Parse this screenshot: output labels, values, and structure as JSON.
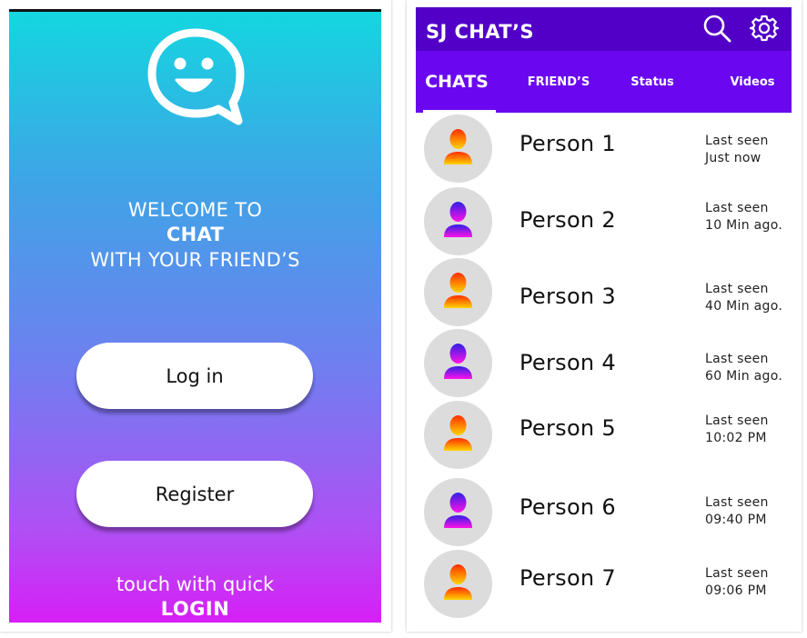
{
  "welcome_screen": {
    "logo_icon": "smiley-chat-bubble-icon",
    "welcome_line1": "WELCOME TO",
    "welcome_line2": "CHAT",
    "welcome_line3": "WITH YOUR FRIEND’S",
    "login_label": "Log in",
    "register_label": "Register",
    "quick_line1": "touch with quick",
    "quick_line2": "LOGIN",
    "colors": {
      "gradient_top": "#14d6e0",
      "gradient_bottom": "#d61ff6",
      "button_bg": "#ffffff"
    }
  },
  "chat_screen": {
    "title": "SJ CHAT’S",
    "header_icons": [
      "search-icon",
      "gear-icon"
    ],
    "tabs": [
      {
        "label": "CHATS",
        "active": true
      },
      {
        "label": "FRIEND’S",
        "active": false
      },
      {
        "label": "Status",
        "active": false
      },
      {
        "label": "Videos",
        "active": false
      }
    ],
    "colors": {
      "topbar": "#5200c8",
      "tabbar": "#6a07f0",
      "avatar_bg": "#dcdcdc",
      "avatar_warm": "#ff3d00",
      "avatar_cool": "#3b1de8"
    },
    "contacts": [
      {
        "name": "Person 1",
        "last_seen_label": "Last seen",
        "last_seen": "Just now",
        "avatar_style": "warm"
      },
      {
        "name": "Person 2",
        "last_seen_label": "Last seen",
        "last_seen": "10 Min ago.",
        "avatar_style": "cool"
      },
      {
        "name": "Person 3",
        "last_seen_label": "Last seen",
        "last_seen": "40 Min ago.",
        "avatar_style": "warm"
      },
      {
        "name": "Person 4",
        "last_seen_label": "Last seen",
        "last_seen": "60 Min ago.",
        "avatar_style": "cool"
      },
      {
        "name": "Person 5",
        "last_seen_label": "Last seen",
        "last_seen": "10:02 PM",
        "avatar_style": "warm"
      },
      {
        "name": "Person 6",
        "last_seen_label": "Last seen",
        "last_seen": "09:40 PM",
        "avatar_style": "cool"
      },
      {
        "name": "Person 7",
        "last_seen_label": "Last seen",
        "last_seen": "09:06 PM",
        "avatar_style": "warm"
      }
    ]
  }
}
